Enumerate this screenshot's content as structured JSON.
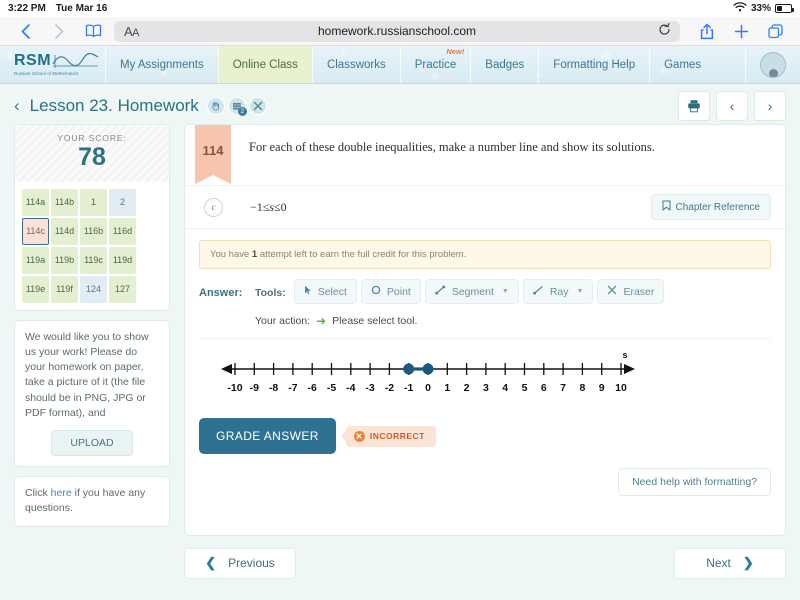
{
  "status_bar": {
    "time": "3:22 PM",
    "date": "Tue Mar 16",
    "wifi_icon": "wifi-icon",
    "battery_percent": "33%"
  },
  "browser": {
    "back_icon": "chevron-left-icon",
    "forward_icon": "chevron-right-icon",
    "bookmarks_icon": "book-icon",
    "aa_label": "AA",
    "url": "homework.russianschool.com",
    "reload_icon": "reload-icon",
    "share_icon": "share-icon",
    "new_tab_icon": "plus-icon",
    "tabs_icon": "tabs-icon"
  },
  "nav": {
    "logo_main": "RSM",
    "logo_sub": "Russian School of Mathematics",
    "tabs": [
      {
        "label": "My Assignments",
        "active": false,
        "badge": ""
      },
      {
        "label": "Online Class",
        "active": true,
        "badge": ""
      },
      {
        "label": "Classworks",
        "active": false,
        "badge": ""
      },
      {
        "label": "Practice",
        "active": false,
        "badge": "New!"
      },
      {
        "label": "Badges",
        "active": false,
        "badge": ""
      },
      {
        "label": "Formatting Help",
        "active": false,
        "badge": ""
      },
      {
        "label": "Games",
        "active": false,
        "badge": ""
      }
    ],
    "avatar_name": "avatar"
  },
  "header": {
    "back_icon": "chevron-left-icon",
    "title": "Lesson 23. Homework",
    "icons": [
      {
        "name": "hand-icon",
        "glyph": "✋",
        "badge": ""
      },
      {
        "name": "books-icon",
        "glyph": "≣",
        "badge": "2"
      },
      {
        "name": "tools-icon",
        "glyph": "✖",
        "badge": ""
      }
    ],
    "actions": [
      {
        "name": "print-button",
        "glyph": "⎙"
      },
      {
        "name": "prev-problem-button",
        "glyph": "‹"
      },
      {
        "name": "next-problem-button",
        "glyph": "›"
      }
    ]
  },
  "sidebar": {
    "score_label": "YOUR SCORE:",
    "score_value": "78",
    "problems": [
      {
        "label": "114a",
        "state": "done"
      },
      {
        "label": "114b",
        "state": "done"
      },
      {
        "label": "1",
        "state": "done"
      },
      {
        "label": "2",
        "state": "todo"
      },
      {
        "label": "114c",
        "state": "selected"
      },
      {
        "label": "114d",
        "state": "done"
      },
      {
        "label": "116b",
        "state": "done"
      },
      {
        "label": "116d",
        "state": "done"
      },
      {
        "label": "119a",
        "state": "done"
      },
      {
        "label": "119b",
        "state": "done"
      },
      {
        "label": "119c",
        "state": "done"
      },
      {
        "label": "119d",
        "state": "done"
      },
      {
        "label": "119e",
        "state": "done"
      },
      {
        "label": "119f",
        "state": "done"
      },
      {
        "label": "124",
        "state": "todo"
      },
      {
        "label": "127",
        "state": "done"
      }
    ],
    "note_text": "We would like you to show us your work! Please do your homework on paper, take a picture of it (the file should be in PNG, JPG or PDF format), and",
    "upload_label": "UPLOAD",
    "help_prefix": "Click ",
    "help_link": "here",
    "help_suffix": " if you have any questions."
  },
  "problem": {
    "number": "114",
    "statement": "For each of these double inequalities, make a number line and show its solutions.",
    "part_letter": "c",
    "inequality_left": "−1≤",
    "inequality_var": "s",
    "inequality_right": "≤0",
    "chapter_reference_label": "Chapter Reference",
    "chapter_reference_icon": "bookmark-icon",
    "alert_prefix": "You have ",
    "alert_count": "1",
    "alert_suffix": " attempt left to earn the full credit for this problem."
  },
  "answer": {
    "answer_label": "Answer:",
    "tools_label": "Tools:",
    "tools": [
      {
        "label": "Select",
        "icon": "cursor-icon",
        "glyph": "➤",
        "caret": false
      },
      {
        "label": "Point",
        "icon": "circle-icon",
        "glyph": "○",
        "caret": false
      },
      {
        "label": "Segment",
        "icon": "segment-icon",
        "glyph": "↗",
        "caret": true
      },
      {
        "label": "Ray",
        "icon": "ray-icon",
        "glyph": "↗",
        "caret": true
      },
      {
        "label": "Eraser",
        "icon": "eraser-icon",
        "glyph": "✕",
        "caret": false
      }
    ],
    "action_label": "Your action:",
    "action_arrow_icon": "arrow-right-icon",
    "action_text": "Please select tool.",
    "grade_label": "GRADE ANSWER",
    "result_badge": "INCORRECT",
    "result_icon": "x-circle-icon",
    "help_formatting_label": "Need help with formatting?"
  },
  "number_line": {
    "axis_label": "s",
    "ticks": [
      "-10",
      "-9",
      "-8",
      "-7",
      "-6",
      "-5",
      "-4",
      "-3",
      "-2",
      "-1",
      "0",
      "1",
      "2",
      "3",
      "4",
      "5",
      "6",
      "7",
      "8",
      "9",
      "10"
    ],
    "min": -10,
    "max": 10,
    "points": [
      {
        "value": -1,
        "filled": true
      },
      {
        "value": 0,
        "filled": true
      }
    ],
    "segments": [
      {
        "from": -1,
        "to": 0
      }
    ],
    "point_color": "#1b5a80"
  },
  "footer": {
    "previous_label": "Previous",
    "previous_icon": "chevron-left-icon",
    "next_label": "Next",
    "next_icon": "chevron-right-icon"
  }
}
